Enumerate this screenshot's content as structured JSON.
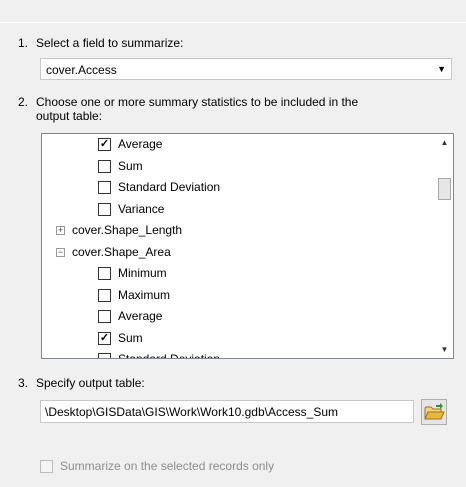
{
  "step1": {
    "number": "1.",
    "label": "Select a field to summarize:",
    "field_value": "cover.Access"
  },
  "step2": {
    "number": "2.",
    "label_line1": "Choose one or more summary statistics to be included in the",
    "label_line2": "output table:",
    "items": [
      {
        "kind": "stat",
        "label": "Average",
        "checked": true
      },
      {
        "kind": "stat",
        "label": "Sum",
        "checked": false
      },
      {
        "kind": "stat",
        "label": "Standard Deviation",
        "checked": false
      },
      {
        "kind": "stat",
        "label": "Variance",
        "checked": false
      },
      {
        "kind": "group",
        "label": "cover.Shape_Length",
        "expanded": false,
        "symbol": "+"
      },
      {
        "kind": "group",
        "label": "cover.Shape_Area",
        "expanded": true,
        "symbol": "−"
      },
      {
        "kind": "stat",
        "label": "Minimum",
        "checked": false
      },
      {
        "kind": "stat",
        "label": "Maximum",
        "checked": false
      },
      {
        "kind": "stat",
        "label": "Average",
        "checked": false
      },
      {
        "kind": "stat",
        "label": "Sum",
        "checked": true
      },
      {
        "kind": "stat",
        "label": "Standard Deviation",
        "checked": false
      }
    ]
  },
  "step3": {
    "number": "3.",
    "label": "Specify output table:",
    "output_path": "\\Desktop\\GISData\\GIS\\Work\\Work10.gdb\\Access_Sum"
  },
  "bottom_option": {
    "label": "Summarize on the selected records only",
    "checked": false,
    "enabled": false
  },
  "icons": {
    "dropdown": "chevron-down-icon",
    "browse": "open-folder-icon"
  },
  "colors": {
    "background": "#f0f0f0",
    "list_border": "#828790",
    "disabled_text": "#8d8d8d",
    "folder": "#e8b63a"
  }
}
